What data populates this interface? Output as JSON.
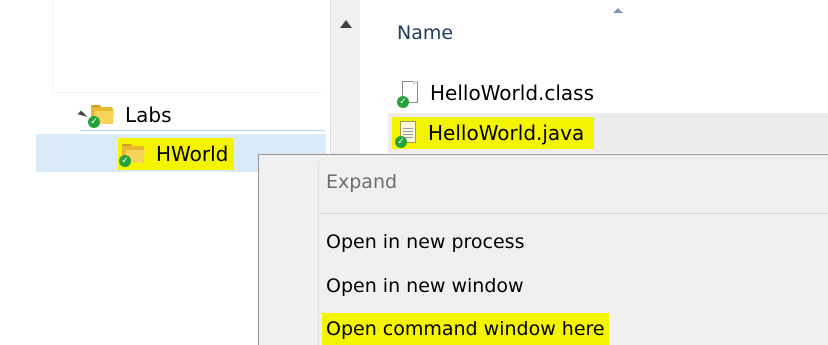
{
  "nav": {
    "items": [
      {
        "label": "Labs",
        "icon": "folder-icon",
        "state": "expanded"
      },
      {
        "label": "HWorld",
        "icon": "folder-icon",
        "state": "selected"
      }
    ]
  },
  "file_list": {
    "column_header": "Name",
    "sort": "ascending",
    "files": [
      {
        "name": "HelloWorld.class",
        "icon": "file-icon"
      },
      {
        "name": "HelloWorld.java",
        "icon": "java-file-icon"
      }
    ]
  },
  "context_menu": {
    "items": [
      {
        "label": "Expand",
        "enabled": false
      },
      {
        "label": "Open in new process",
        "enabled": true
      },
      {
        "label": "Open in new window",
        "enabled": true
      },
      {
        "label": "Open command window here",
        "enabled": true,
        "highlighted": true
      }
    ]
  },
  "colors": {
    "highlight": "#f4f400",
    "selection": "#d9ebfb",
    "menu_background": "#f0f0f0",
    "header_text": "#1e3a5c"
  }
}
